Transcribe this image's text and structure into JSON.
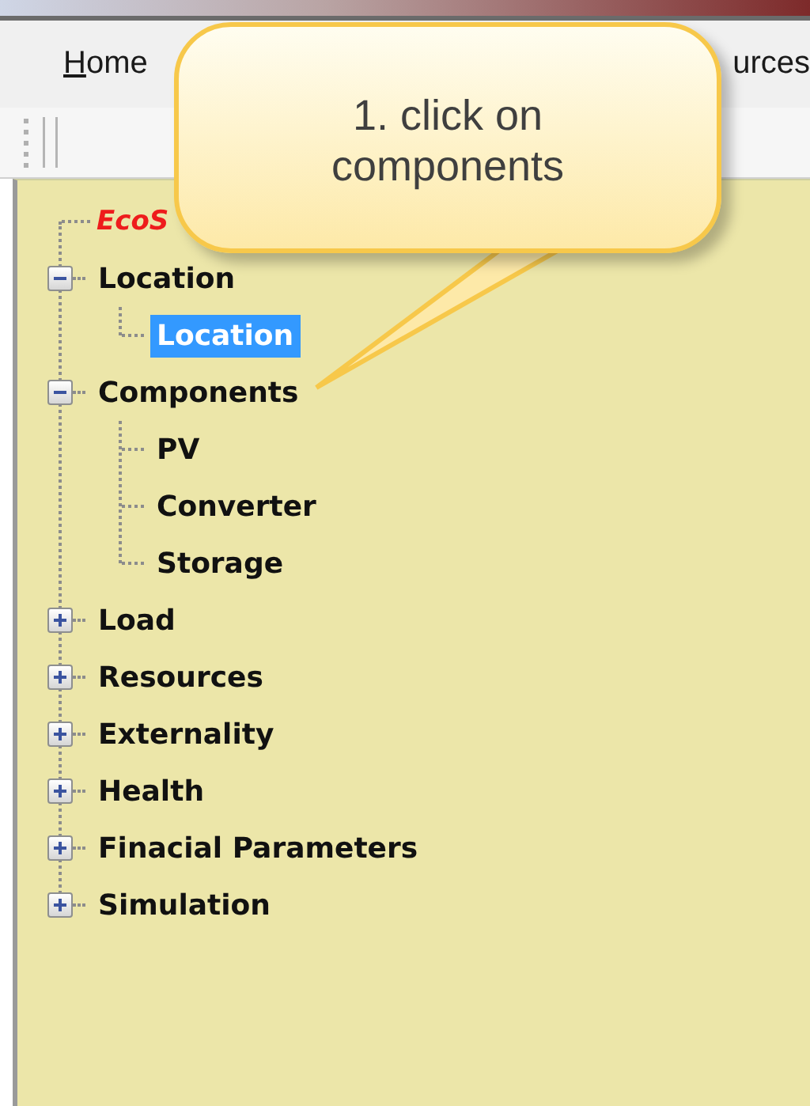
{
  "menu_bar": {
    "items": [
      {
        "label": "Home"
      },
      {
        "label": "urces"
      }
    ]
  },
  "callout": {
    "text": "1. click on components"
  },
  "tree": {
    "root": {
      "label": "EcoS"
    },
    "items": [
      {
        "label": "Location",
        "expanded": true,
        "selected": false,
        "children": [
          {
            "label": "Location",
            "selected": true
          }
        ]
      },
      {
        "label": "Components",
        "expanded": true,
        "selected": false,
        "children": [
          {
            "label": "PV",
            "selected": false
          },
          {
            "label": "Converter",
            "selected": false
          },
          {
            "label": "Storage",
            "selected": false
          }
        ]
      },
      {
        "label": "Load",
        "expanded": false,
        "selected": false
      },
      {
        "label": "Resources",
        "expanded": false,
        "selected": false
      },
      {
        "label": "Externality",
        "expanded": false,
        "selected": false
      },
      {
        "label": "Health",
        "expanded": false,
        "selected": false
      },
      {
        "label": "Finacial Parameters",
        "expanded": false,
        "selected": false
      },
      {
        "label": "Simulation",
        "expanded": false,
        "selected": false
      }
    ]
  }
}
